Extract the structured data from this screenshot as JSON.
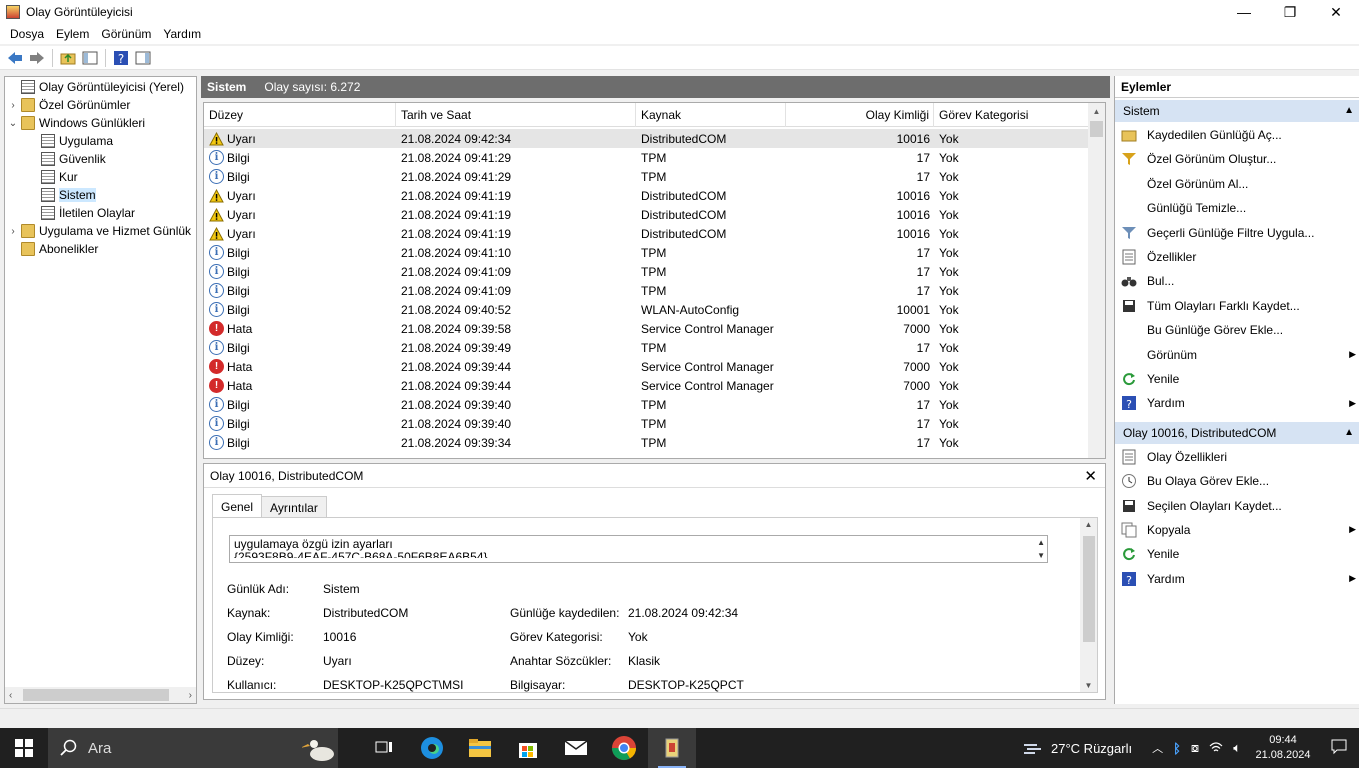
{
  "window": {
    "title": "Olay Görüntüleyicisi",
    "minimize": "—",
    "maximize": "❐",
    "close": "✕"
  },
  "menu": [
    "Dosya",
    "Eylem",
    "Görünüm",
    "Yardım"
  ],
  "tree": {
    "items": [
      {
        "label": "Olay Görüntüleyicisi (Yerel)",
        "expander": ""
      },
      {
        "label": "Özel Görünümler",
        "expander": "›"
      },
      {
        "label": "Windows Günlükleri",
        "expander": "⌄"
      },
      {
        "label": "Uygulama",
        "expander": ""
      },
      {
        "label": "Güvenlik",
        "expander": ""
      },
      {
        "label": "Kur",
        "expander": ""
      },
      {
        "label": "Sistem",
        "expander": ""
      },
      {
        "label": "İletilen Olaylar",
        "expander": ""
      },
      {
        "label": "Uygulama ve Hizmet Günlük",
        "expander": "›"
      },
      {
        "label": "Abonelikler",
        "expander": ""
      }
    ]
  },
  "center": {
    "title": "Sistem",
    "count": "Olay sayısı: 6.272",
    "columns": [
      "Düzey",
      "Tarih ve Saat",
      "Kaynak",
      "Olay Kimliği",
      "Görev Kategorisi"
    ],
    "rows": [
      {
        "level": "Uyarı",
        "type": "warn",
        "date": "21.08.2024 09:42:34",
        "source": "DistributedCOM",
        "id": "10016",
        "cat": "Yok"
      },
      {
        "level": "Bilgi",
        "type": "info",
        "date": "21.08.2024 09:41:29",
        "source": "TPM",
        "id": "17",
        "cat": "Yok"
      },
      {
        "level": "Bilgi",
        "type": "info",
        "date": "21.08.2024 09:41:29",
        "source": "TPM",
        "id": "17",
        "cat": "Yok"
      },
      {
        "level": "Uyarı",
        "type": "warn",
        "date": "21.08.2024 09:41:19",
        "source": "DistributedCOM",
        "id": "10016",
        "cat": "Yok"
      },
      {
        "level": "Uyarı",
        "type": "warn",
        "date": "21.08.2024 09:41:19",
        "source": "DistributedCOM",
        "id": "10016",
        "cat": "Yok"
      },
      {
        "level": "Uyarı",
        "type": "warn",
        "date": "21.08.2024 09:41:19",
        "source": "DistributedCOM",
        "id": "10016",
        "cat": "Yok"
      },
      {
        "level": "Bilgi",
        "type": "info",
        "date": "21.08.2024 09:41:10",
        "source": "TPM",
        "id": "17",
        "cat": "Yok"
      },
      {
        "level": "Bilgi",
        "type": "info",
        "date": "21.08.2024 09:41:09",
        "source": "TPM",
        "id": "17",
        "cat": "Yok"
      },
      {
        "level": "Bilgi",
        "type": "info",
        "date": "21.08.2024 09:41:09",
        "source": "TPM",
        "id": "17",
        "cat": "Yok"
      },
      {
        "level": "Bilgi",
        "type": "info",
        "date": "21.08.2024 09:40:52",
        "source": "WLAN-AutoConfig",
        "id": "10001",
        "cat": "Yok"
      },
      {
        "level": "Hata",
        "type": "err",
        "date": "21.08.2024 09:39:58",
        "source": "Service Control Manager",
        "id": "7000",
        "cat": "Yok"
      },
      {
        "level": "Bilgi",
        "type": "info",
        "date": "21.08.2024 09:39:49",
        "source": "TPM",
        "id": "17",
        "cat": "Yok"
      },
      {
        "level": "Hata",
        "type": "err",
        "date": "21.08.2024 09:39:44",
        "source": "Service Control Manager",
        "id": "7000",
        "cat": "Yok"
      },
      {
        "level": "Hata",
        "type": "err",
        "date": "21.08.2024 09:39:44",
        "source": "Service Control Manager",
        "id": "7000",
        "cat": "Yok"
      },
      {
        "level": "Bilgi",
        "type": "info",
        "date": "21.08.2024 09:39:40",
        "source": "TPM",
        "id": "17",
        "cat": "Yok"
      },
      {
        "level": "Bilgi",
        "type": "info",
        "date": "21.08.2024 09:39:40",
        "source": "TPM",
        "id": "17",
        "cat": "Yok"
      },
      {
        "level": "Bilgi",
        "type": "info",
        "date": "21.08.2024 09:39:34",
        "source": "TPM",
        "id": "17",
        "cat": "Yok"
      }
    ]
  },
  "details": {
    "title": "Olay 10016, DistributedCOM",
    "close": "✕",
    "tabs": [
      "Genel",
      "Ayrıntılar"
    ],
    "desc_line1": "uygulamaya özgü izin ayarları",
    "desc_line2": "{2593F8B9-4EAF-457C-B68A-50F6B8EA6B54}",
    "props": {
      "log_name_label": "Günlük Adı:",
      "log_name": "Sistem",
      "source_label": "Kaynak:",
      "source": "DistributedCOM",
      "logged_label": "Günlüğe kaydedilen:",
      "logged": "21.08.2024 09:42:34",
      "event_id_label": "Olay Kimliği:",
      "event_id": "10016",
      "task_label": "Görev Kategorisi:",
      "task": "Yok",
      "level_label": "Düzey:",
      "level": "Uyarı",
      "keywords_label": "Anahtar Sözcükler:",
      "keywords": "Klasik",
      "user_label": "Kullanıcı:",
      "user": "DESKTOP-K25QPCT\\MSI",
      "computer_label": "Bilgisayar:",
      "computer": "DESKTOP-K25QPCT"
    }
  },
  "actions": {
    "title": "Eylemler",
    "section1": "Sistem",
    "items1": [
      {
        "label": "Kaydedilen Günlüğü Aç...",
        "icon": "open-log-icon",
        "sub": ""
      },
      {
        "label": "Özel Görünüm Oluştur...",
        "icon": "filter-create-icon",
        "sub": ""
      },
      {
        "label": "Özel Görünüm Al...",
        "icon": "",
        "sub": ""
      },
      {
        "label": "Günlüğü Temizle...",
        "icon": "",
        "sub": ""
      },
      {
        "label": "Geçerli Günlüğe Filtre Uygula...",
        "icon": "filter-icon",
        "sub": ""
      },
      {
        "label": "Özellikler",
        "icon": "properties-icon",
        "sub": ""
      },
      {
        "label": "Bul...",
        "icon": "binoculars-icon",
        "sub": ""
      },
      {
        "label": "Tüm Olayları Farklı Kaydet...",
        "icon": "save-icon",
        "sub": ""
      },
      {
        "label": "Bu Günlüğe Görev Ekle...",
        "icon": "",
        "sub": ""
      },
      {
        "label": "Görünüm",
        "icon": "",
        "sub": "▶"
      },
      {
        "label": "Yenile",
        "icon": "refresh-icon",
        "sub": ""
      },
      {
        "label": "Yardım",
        "icon": "help-icon",
        "sub": "▶"
      }
    ],
    "section2": "Olay 10016, DistributedCOM",
    "items2": [
      {
        "label": "Olay Özellikleri",
        "icon": "properties-icon",
        "sub": ""
      },
      {
        "label": "Bu Olaya Görev Ekle...",
        "icon": "task-icon",
        "sub": ""
      },
      {
        "label": "Seçilen Olayları Kaydet...",
        "icon": "save-icon",
        "sub": ""
      },
      {
        "label": "Kopyala",
        "icon": "copy-icon",
        "sub": "▶"
      },
      {
        "label": "Yenile",
        "icon": "refresh-icon",
        "sub": ""
      },
      {
        "label": "Yardım",
        "icon": "help-icon",
        "sub": "▶"
      }
    ]
  },
  "taskbar": {
    "search_placeholder": "Ara",
    "weather": "27°C  Rüzgarlı",
    "time": "09:44",
    "date": "21.08.2024"
  }
}
